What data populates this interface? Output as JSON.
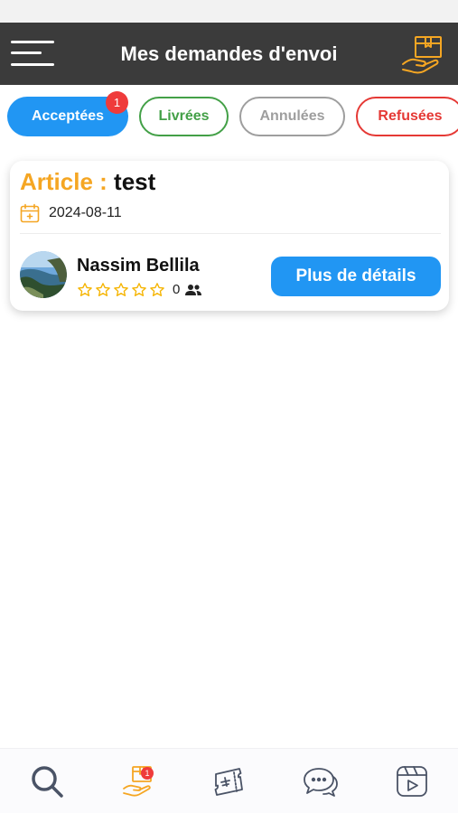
{
  "header": {
    "title": "Mes demandes d'envoi",
    "menu_icon": "hamburger-menu-icon",
    "logo_icon": "package-hand-icon"
  },
  "tabs": [
    {
      "label": "Acceptées",
      "active": true,
      "badge": "1",
      "color": "#2196f3"
    },
    {
      "label": "Livrées",
      "active": false,
      "color": "#43a047"
    },
    {
      "label": "Annulées",
      "active": false,
      "color": "#9e9e9e"
    },
    {
      "label": "Refusées",
      "active": false,
      "color": "#e53935"
    }
  ],
  "card": {
    "article_label": "Article : ",
    "article_name": "test",
    "date": "2024-08-11",
    "user": {
      "name": "Nassim Bellila",
      "rating_stars": 0,
      "rating_max": 5,
      "review_count": "0"
    },
    "details_button": "Plus de détails"
  },
  "bottom_nav": {
    "items": [
      {
        "icon": "search-icon"
      },
      {
        "icon": "package-hand-icon",
        "active": true,
        "badge": "1"
      },
      {
        "icon": "ticket-plane-icon"
      },
      {
        "icon": "chat-bubbles-icon"
      },
      {
        "icon": "video-play-icon"
      }
    ]
  },
  "colors": {
    "header_bg": "#3b3b3b",
    "accent_blue": "#2196f3",
    "accent_orange": "#f5a623",
    "badge_red": "#ef3b3b",
    "nav_icon": "#4a5366"
  }
}
